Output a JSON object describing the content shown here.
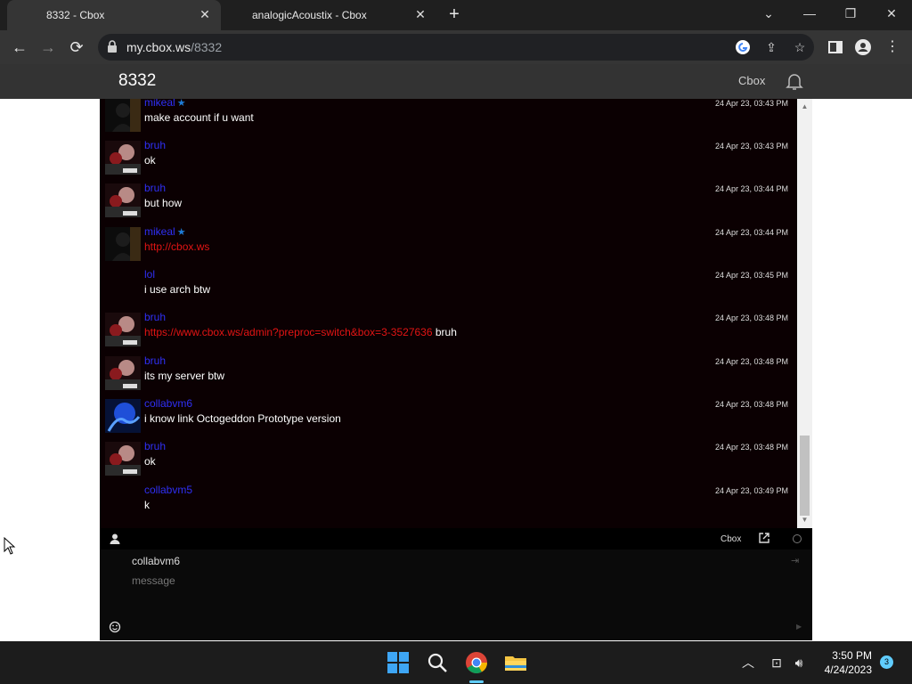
{
  "browser": {
    "tabs": [
      {
        "title": "8332 - Cbox",
        "close": "✕"
      },
      {
        "title": "analogicAcoustix - Cbox",
        "close": "✕"
      }
    ],
    "new_tab": "+",
    "window_controls": {
      "dropdown": "⌄",
      "minimize": "—",
      "restore": "❐",
      "close": "✕"
    },
    "url_host": "my.cbox.ws",
    "url_path": "/8332",
    "nav": {
      "back": "←",
      "forward": "→",
      "reload": "⟳"
    },
    "omnibox_icons": {
      "share": "⇪",
      "bookmark": "☆"
    },
    "toolbar_icons": {
      "menu": "⋮"
    }
  },
  "site": {
    "title": "8332",
    "brand": "Cbox"
  },
  "chat": {
    "messages": [
      {
        "user": "mikeal",
        "star": "★",
        "text": "make account if u want",
        "link": "",
        "suffix": "",
        "time": "24 Apr 23, 03:43 PM",
        "avatar": "dark"
      },
      {
        "user": "bruh",
        "star": "",
        "text": "ok",
        "link": "",
        "suffix": "",
        "time": "24 Apr 23, 03:43 PM",
        "avatar": "bruh"
      },
      {
        "user": "bruh",
        "star": "",
        "text": "but how",
        "link": "",
        "suffix": "",
        "time": "24 Apr 23, 03:44 PM",
        "avatar": "bruh"
      },
      {
        "user": "mikeal",
        "star": "★",
        "text": "",
        "link": "http://cbox.ws",
        "suffix": "",
        "time": "24 Apr 23, 03:44 PM",
        "avatar": "dark"
      },
      {
        "user": "lol",
        "star": "",
        "text": "i use arch btw",
        "link": "",
        "suffix": "",
        "time": "24 Apr 23, 03:45 PM",
        "avatar": "none"
      },
      {
        "user": "bruh",
        "star": "",
        "text": "",
        "link": "https://www.cbox.ws/admin?preproc=switch&box=3-3527636",
        "suffix": " bruh",
        "time": "24 Apr 23, 03:48 PM",
        "avatar": "bruh"
      },
      {
        "user": "bruh",
        "star": "",
        "text": "its my server btw",
        "link": "",
        "suffix": "",
        "time": "24 Apr 23, 03:48 PM",
        "avatar": "bruh"
      },
      {
        "user": "collabvm6",
        "star": "",
        "text": "i know link Octogeddon Prototype version",
        "link": "",
        "suffix": "",
        "time": "24 Apr 23, 03:48 PM",
        "avatar": "blue"
      },
      {
        "user": "bruh",
        "star": "",
        "text": "ok",
        "link": "",
        "suffix": "",
        "time": "24 Apr 23, 03:48 PM",
        "avatar": "bruh"
      },
      {
        "user": "collabvm5",
        "star": "",
        "text": "k",
        "link": "",
        "suffix": "",
        "time": "24 Apr 23, 03:49 PM",
        "avatar": "none"
      }
    ],
    "scroll_fraction": 0.88
  },
  "statusbar": {
    "brand": "Cbox"
  },
  "input": {
    "name_value": "collabvm6",
    "message_placeholder": "message"
  },
  "taskbar": {
    "time": "3:50 PM",
    "date": "4/24/2023",
    "notifications": "3",
    "tray": {
      "chevron": "︿",
      "network": "⊡",
      "volume": "🔊︎"
    }
  },
  "colors": {
    "username": "#2f2ff5",
    "link": "#e21414",
    "chat_bg": "#0b0002",
    "accent": "#60cdff"
  }
}
